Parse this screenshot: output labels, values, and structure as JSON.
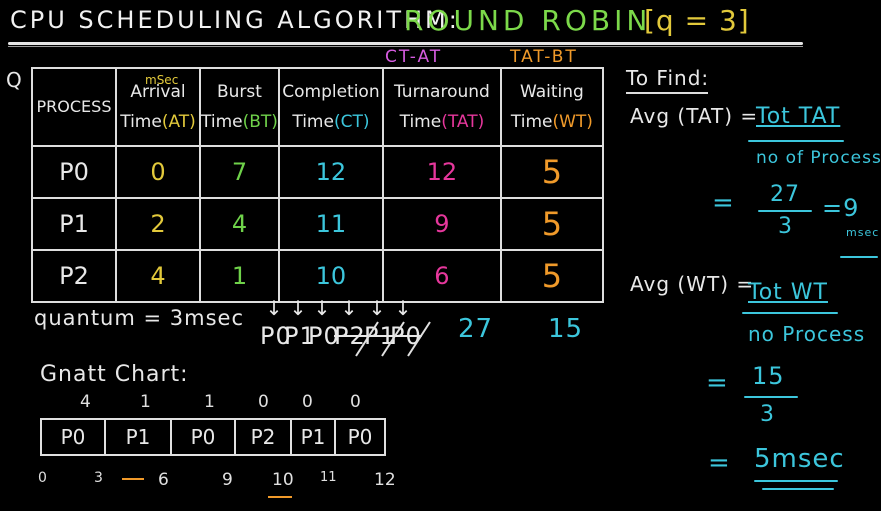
{
  "title": {
    "text": "CPU SCHEDULING ALGORITHM:",
    "algorithm": "ROUND ROBIN",
    "quantum_expr": "[q = 3]"
  },
  "formulas": {
    "ct_at": "CT-AT",
    "tat_bt": "TAT-BT"
  },
  "q_marker": "Q",
  "table": {
    "headers": {
      "process": "PROCESS",
      "msec": "mSec",
      "arrival_1": "Arrival",
      "arrival_2": "Time",
      "arrival_abbr": "(AT)",
      "burst_1": "Burst",
      "burst_2": "Time",
      "burst_abbr": "(BT)",
      "completion_1": "Completion",
      "completion_2": "Time",
      "completion_abbr": "(CT)",
      "turnaround_1": "Turnaround",
      "turnaround_2": "Time",
      "turnaround_abbr": "(TAT)",
      "waiting_1": "Waiting",
      "waiting_2": "Time",
      "waiting_abbr": "(WT)"
    },
    "rows": [
      {
        "process": "P0",
        "at": "0",
        "bt": "7",
        "ct": "12",
        "tat": "12",
        "wt": "5"
      },
      {
        "process": "P1",
        "at": "2",
        "bt": "4",
        "ct": "11",
        "tat": "9",
        "wt": "5"
      },
      {
        "process": "P2",
        "at": "4",
        "bt": "1",
        "ct": "10",
        "tat": "6",
        "wt": "5"
      }
    ]
  },
  "quantum_text": "quantum = 3msec",
  "queue": {
    "arrows": [
      "↓",
      "↓",
      "↓",
      "↓",
      "↓",
      "↓"
    ],
    "items": [
      "P0",
      "P1",
      "P0",
      "P2",
      "P1",
      "P0"
    ]
  },
  "sum_tat": "27",
  "sum_wt": "15",
  "gantt": {
    "title": "Gnatt Chart:",
    "cells": [
      "P0",
      "P1",
      "P0",
      "P2",
      "P1",
      "P0"
    ],
    "remaining": [
      "4",
      "1",
      "1",
      "0",
      "0",
      "0"
    ],
    "ticks": [
      "0",
      "3",
      "6",
      "9",
      "10",
      "11",
      "12"
    ]
  },
  "to_find": {
    "heading": "To Find:",
    "avg_tat_label": "Avg (TAT) =",
    "tot_tat": "Tot TAT",
    "no_process_1": "no of Process",
    "eq1": "=",
    "num_27": "27",
    "den_3a": "3",
    "eq_9": "=9",
    "msec_small": "msec",
    "avg_wt_label": "Avg (WT) =",
    "tot_wt": "Tot WT",
    "no_process_2": "no Process",
    "eq2": "=",
    "num_15": "15",
    "den_3b": "3",
    "eq3": "=",
    "result": "5msec"
  }
}
